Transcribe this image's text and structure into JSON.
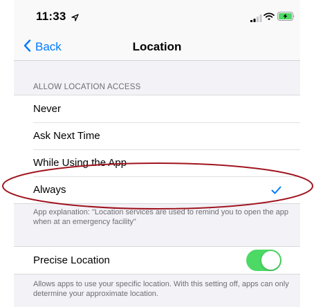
{
  "status_bar": {
    "time": "11:33",
    "icons": [
      "location-arrow-icon",
      "signal-icon",
      "wifi-icon",
      "battery-charging-icon"
    ]
  },
  "nav": {
    "back_label": "Back",
    "title": "Location"
  },
  "location_access": {
    "header": "ALLOW LOCATION ACCESS",
    "options": [
      {
        "label": "Never",
        "selected": false
      },
      {
        "label": "Ask Next Time",
        "selected": false
      },
      {
        "label": "While Using the App",
        "selected": false
      },
      {
        "label": "Always",
        "selected": true
      }
    ],
    "explanation": "App explanation: \"Location services are used to remind you to open the app when at an emergency facility\""
  },
  "precise_location": {
    "label": "Precise Location",
    "enabled": true,
    "description": "Allows apps to use your specific location. With this setting off, apps can only determine your approximate location."
  },
  "colors": {
    "accent": "#007aff",
    "toggle_on": "#4cd964",
    "annotation": "#a0141e",
    "background": "#f2f2f7"
  }
}
